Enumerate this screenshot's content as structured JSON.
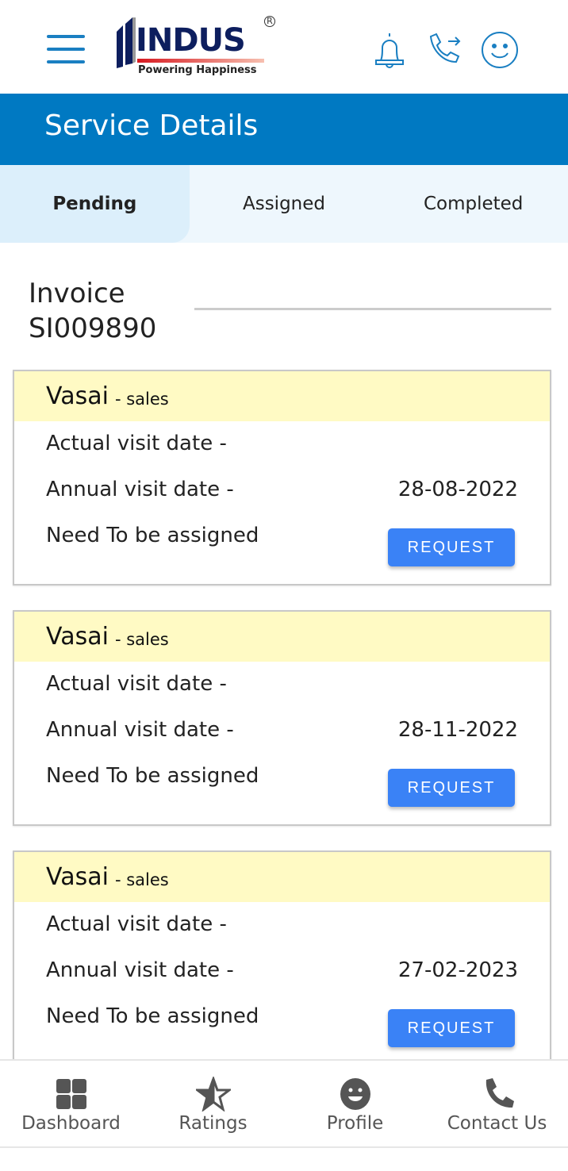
{
  "header": {
    "logo_text": "INDUS",
    "logo_tagline": "Powering Happiness",
    "icons": [
      "menu-icon",
      "bell-icon",
      "call-forward-icon",
      "smiley-icon"
    ]
  },
  "banner": {
    "title": "Service Details",
    "color": "#0079c2"
  },
  "tabs": [
    {
      "label": "Pending",
      "active": true
    },
    {
      "label": "Assigned",
      "active": false
    },
    {
      "label": "Completed",
      "active": false
    }
  ],
  "invoice": {
    "label": "Invoice",
    "number": "SI009890"
  },
  "cards": [
    {
      "location": "Vasai",
      "type": "- sales",
      "actual_label": "Actual visit date -",
      "actual_value": "",
      "annual_label": "Annual visit date -",
      "annual_value": "28-08-2022",
      "status": "Need To be assigned",
      "button": "REQUEST"
    },
    {
      "location": "Vasai",
      "type": "- sales",
      "actual_label": "Actual visit date -",
      "actual_value": "",
      "annual_label": "Annual visit date -",
      "annual_value": "28-11-2022",
      "status": "Need To be assigned",
      "button": "REQUEST"
    },
    {
      "location": "Vasai",
      "type": "- sales",
      "actual_label": "Actual visit date -",
      "actual_value": "",
      "annual_label": "Annual visit date -",
      "annual_value": "27-02-2023",
      "status": "Need To be assigned",
      "button": "REQUEST"
    }
  ],
  "bottom_nav": [
    {
      "label": "Dashboard",
      "icon": "grid-icon"
    },
    {
      "label": "Ratings",
      "icon": "star-icon"
    },
    {
      "label": "Profile",
      "icon": "face-icon"
    },
    {
      "label": "Contact Us",
      "icon": "phone-icon"
    }
  ]
}
